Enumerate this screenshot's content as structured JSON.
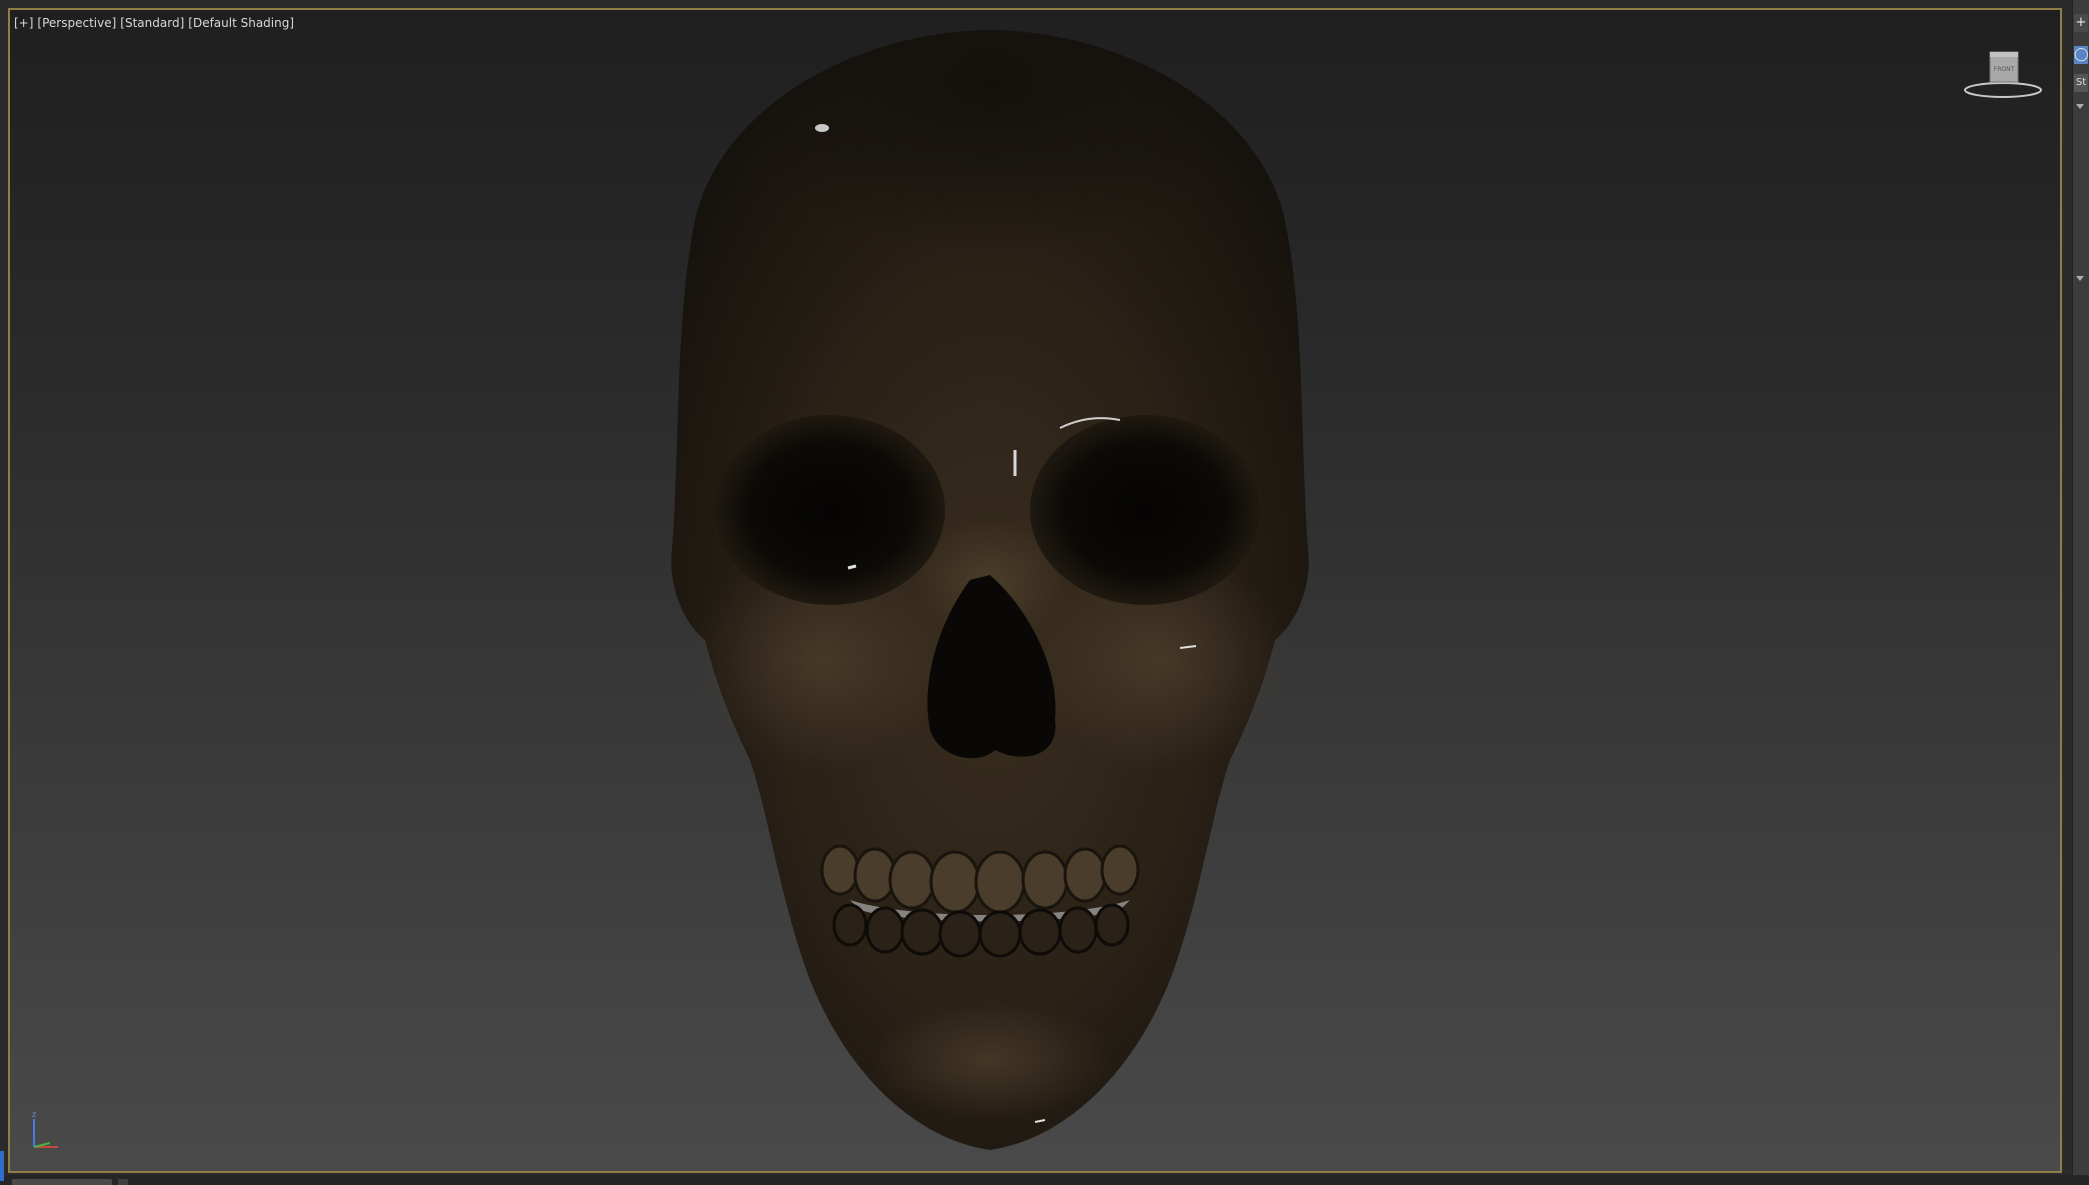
{
  "viewport": {
    "labels": {
      "menu": "[+]",
      "view": "[Perspective]",
      "mode": "[Standard]",
      "shading": "[Default Shading]"
    },
    "viewcube_face": "FRONT",
    "axis_label": "z"
  },
  "right_panel": {
    "create_icon": "+",
    "tab_label": "St"
  },
  "colors": {
    "viewport_border": "#8f7e48",
    "active_blue": "#5b84c4"
  },
  "icons": {
    "create": "plus-icon",
    "viewcube": "viewcube-icon",
    "axis": "axis-tripod-icon"
  }
}
